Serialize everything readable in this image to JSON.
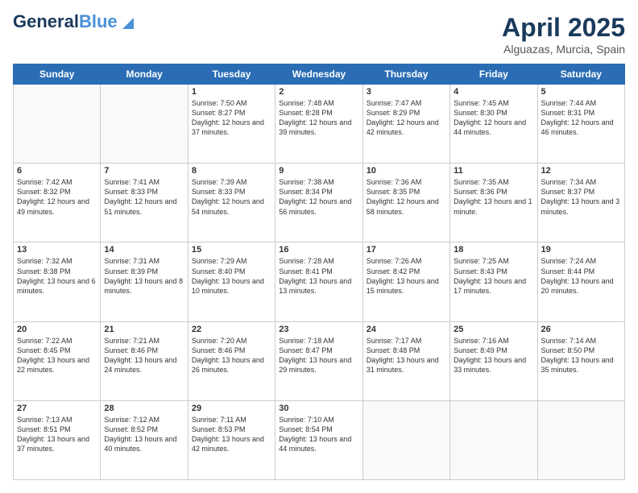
{
  "header": {
    "logo_general": "General",
    "logo_blue": "Blue",
    "title": "April 2025",
    "subtitle": "Alguazas, Murcia, Spain"
  },
  "days_of_week": [
    "Sunday",
    "Monday",
    "Tuesday",
    "Wednesday",
    "Thursday",
    "Friday",
    "Saturday"
  ],
  "weeks": [
    [
      {
        "day": "",
        "info": ""
      },
      {
        "day": "",
        "info": ""
      },
      {
        "day": "1",
        "info": "Sunrise: 7:50 AM\nSunset: 8:27 PM\nDaylight: 12 hours and 37 minutes."
      },
      {
        "day": "2",
        "info": "Sunrise: 7:48 AM\nSunset: 8:28 PM\nDaylight: 12 hours and 39 minutes."
      },
      {
        "day": "3",
        "info": "Sunrise: 7:47 AM\nSunset: 8:29 PM\nDaylight: 12 hours and 42 minutes."
      },
      {
        "day": "4",
        "info": "Sunrise: 7:45 AM\nSunset: 8:30 PM\nDaylight: 12 hours and 44 minutes."
      },
      {
        "day": "5",
        "info": "Sunrise: 7:44 AM\nSunset: 8:31 PM\nDaylight: 12 hours and 46 minutes."
      }
    ],
    [
      {
        "day": "6",
        "info": "Sunrise: 7:42 AM\nSunset: 8:32 PM\nDaylight: 12 hours and 49 minutes."
      },
      {
        "day": "7",
        "info": "Sunrise: 7:41 AM\nSunset: 8:33 PM\nDaylight: 12 hours and 51 minutes."
      },
      {
        "day": "8",
        "info": "Sunrise: 7:39 AM\nSunset: 8:33 PM\nDaylight: 12 hours and 54 minutes."
      },
      {
        "day": "9",
        "info": "Sunrise: 7:38 AM\nSunset: 8:34 PM\nDaylight: 12 hours and 56 minutes."
      },
      {
        "day": "10",
        "info": "Sunrise: 7:36 AM\nSunset: 8:35 PM\nDaylight: 12 hours and 58 minutes."
      },
      {
        "day": "11",
        "info": "Sunrise: 7:35 AM\nSunset: 8:36 PM\nDaylight: 13 hours and 1 minute."
      },
      {
        "day": "12",
        "info": "Sunrise: 7:34 AM\nSunset: 8:37 PM\nDaylight: 13 hours and 3 minutes."
      }
    ],
    [
      {
        "day": "13",
        "info": "Sunrise: 7:32 AM\nSunset: 8:38 PM\nDaylight: 13 hours and 6 minutes."
      },
      {
        "day": "14",
        "info": "Sunrise: 7:31 AM\nSunset: 8:39 PM\nDaylight: 13 hours and 8 minutes."
      },
      {
        "day": "15",
        "info": "Sunrise: 7:29 AM\nSunset: 8:40 PM\nDaylight: 13 hours and 10 minutes."
      },
      {
        "day": "16",
        "info": "Sunrise: 7:28 AM\nSunset: 8:41 PM\nDaylight: 13 hours and 13 minutes."
      },
      {
        "day": "17",
        "info": "Sunrise: 7:26 AM\nSunset: 8:42 PM\nDaylight: 13 hours and 15 minutes."
      },
      {
        "day": "18",
        "info": "Sunrise: 7:25 AM\nSunset: 8:43 PM\nDaylight: 13 hours and 17 minutes."
      },
      {
        "day": "19",
        "info": "Sunrise: 7:24 AM\nSunset: 8:44 PM\nDaylight: 13 hours and 20 minutes."
      }
    ],
    [
      {
        "day": "20",
        "info": "Sunrise: 7:22 AM\nSunset: 8:45 PM\nDaylight: 13 hours and 22 minutes."
      },
      {
        "day": "21",
        "info": "Sunrise: 7:21 AM\nSunset: 8:46 PM\nDaylight: 13 hours and 24 minutes."
      },
      {
        "day": "22",
        "info": "Sunrise: 7:20 AM\nSunset: 8:46 PM\nDaylight: 13 hours and 26 minutes."
      },
      {
        "day": "23",
        "info": "Sunrise: 7:18 AM\nSunset: 8:47 PM\nDaylight: 13 hours and 29 minutes."
      },
      {
        "day": "24",
        "info": "Sunrise: 7:17 AM\nSunset: 8:48 PM\nDaylight: 13 hours and 31 minutes."
      },
      {
        "day": "25",
        "info": "Sunrise: 7:16 AM\nSunset: 8:49 PM\nDaylight: 13 hours and 33 minutes."
      },
      {
        "day": "26",
        "info": "Sunrise: 7:14 AM\nSunset: 8:50 PM\nDaylight: 13 hours and 35 minutes."
      }
    ],
    [
      {
        "day": "27",
        "info": "Sunrise: 7:13 AM\nSunset: 8:51 PM\nDaylight: 13 hours and 37 minutes."
      },
      {
        "day": "28",
        "info": "Sunrise: 7:12 AM\nSunset: 8:52 PM\nDaylight: 13 hours and 40 minutes."
      },
      {
        "day": "29",
        "info": "Sunrise: 7:11 AM\nSunset: 8:53 PM\nDaylight: 13 hours and 42 minutes."
      },
      {
        "day": "30",
        "info": "Sunrise: 7:10 AM\nSunset: 8:54 PM\nDaylight: 13 hours and 44 minutes."
      },
      {
        "day": "",
        "info": ""
      },
      {
        "day": "",
        "info": ""
      },
      {
        "day": "",
        "info": ""
      }
    ]
  ]
}
